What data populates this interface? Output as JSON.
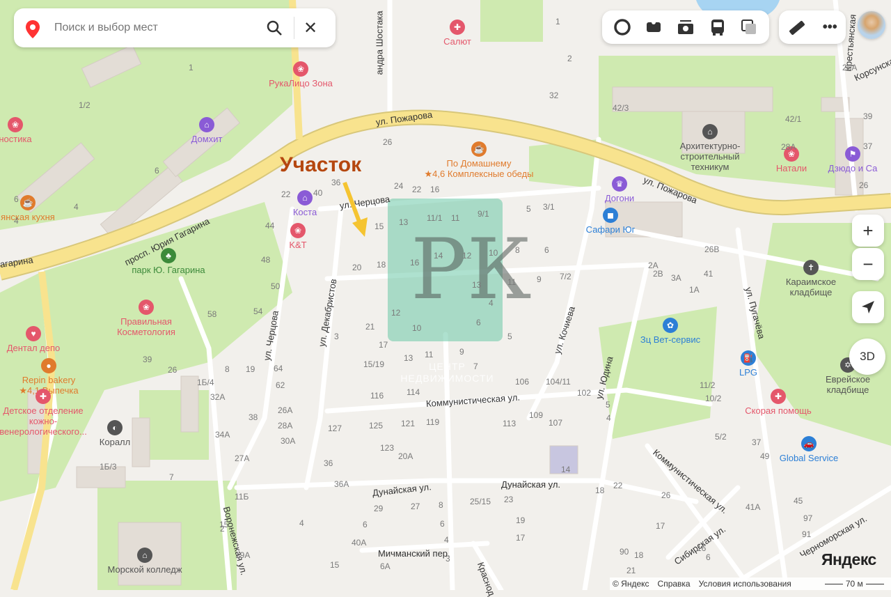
{
  "search": {
    "placeholder": "Поиск и выбор мест"
  },
  "toolbar": {
    "layers_icon": "layers-icon",
    "items": [
      "traffic-icon",
      "panorama-icon",
      "photo-icon",
      "transit-icon",
      "layers-icon"
    ],
    "ruler": "ruler-icon",
    "more": "more-icon"
  },
  "controls": {
    "zoom_in": "+",
    "zoom_out": "−",
    "threed": "3D"
  },
  "annotation": {
    "label": "Участок",
    "color": "#b5470f",
    "arrow_color": "#f5c431"
  },
  "watermark": {
    "logo": "РК",
    "text": "ЦЕНТР НЕДВИЖИМОСТИ"
  },
  "streets": {
    "pozharova1": "ул. Пожарова",
    "pozharova2": "ул. Пожарова",
    "gagarina": "просп. Юрия Гагарина",
    "gagarina2": "агарина",
    "chertsova": "ул. Черцова",
    "chertsova2": "ул. Черцова",
    "dekabristov": "ул. Декабристов",
    "kommunisticheskaya": "Коммунистическая ул.",
    "kommunisticheskaya2": "Коммунистическая ул.",
    "dunayskaya1": "Дунайская ул.",
    "dunayskaya2": "Дунайская ул.",
    "michmansky": "Мичманский пер.",
    "voronezhskaya": "Воронежская ул.",
    "kochieva": "ул. Кочиева",
    "yudina": "ул. Юдина",
    "pugacheva": "ул. Пугачёва",
    "sibirskaya": "Сибирская ул.",
    "chernomorskaya": "Черноморская ул.",
    "shostaka": "андра Шостака",
    "krestyanskaya": "Крестьянская",
    "korsunskaya": "Корсунска",
    "krasnodar": "Краснод"
  },
  "pois": [
    {
      "name": "Салют",
      "color": "#e4576b"
    },
    {
      "name": "РукаЛицо Зона",
      "color": "#e4576b"
    },
    {
      "name": "Домхит",
      "color": "#8a5bd6"
    },
    {
      "name": "По Домашнему",
      "sub": "★4,6 Комплексные обеды",
      "color": "#e07b2d"
    },
    {
      "name": "Архитектурно-строительный техникум",
      "color": "#555"
    },
    {
      "name": "Натали",
      "color": "#e4576b"
    },
    {
      "name": "Дзюдо и Са",
      "color": "#8a5bd6"
    },
    {
      "name": "Догони",
      "color": "#8a5bd6"
    },
    {
      "name": "Сафари Юг",
      "color": "#2c7fd6"
    },
    {
      "name": "Коста",
      "color": "#8a5bd6"
    },
    {
      "name": "K&T",
      "color": "#e4576b"
    },
    {
      "name": "парк Ю. Гагарина",
      "color": "#3c8a3a"
    },
    {
      "name": "Правильная Косметология",
      "color": "#e4576b"
    },
    {
      "name": "Дентал депо",
      "color": "#e4576b"
    },
    {
      "name": "Repin bakery",
      "sub": "★4,1 Выпечка",
      "color": "#e07b2d"
    },
    {
      "name": "Детское отделение кожно-венерологического...",
      "color": "#e4576b"
    },
    {
      "name": "Коралл",
      "color": "#555"
    },
    {
      "name": "Зц Вет-сервис",
      "color": "#2c7fd6"
    },
    {
      "name": "LPG",
      "color": "#2c7fd6"
    },
    {
      "name": "Скорая помощь",
      "color": "#e4576b"
    },
    {
      "name": "Караимское кладбище",
      "color": "#555"
    },
    {
      "name": "Еврейское кладбище",
      "color": "#555"
    },
    {
      "name": "Global Service",
      "color": "#2c7fd6"
    },
    {
      "name": "Морской колледж",
      "color": "#555"
    },
    {
      "name": "ностика",
      "color": "#e4576b"
    },
    {
      "name": "янская кухня",
      "color": "#e07b2d"
    }
  ],
  "houses": [
    "26",
    "24",
    "22",
    "16",
    "36",
    "40",
    "22",
    "44",
    "48",
    "50",
    "54",
    "58",
    "15",
    "13",
    "11/1",
    "11",
    "9/1",
    "5",
    "3/1",
    "8",
    "6",
    "20",
    "18",
    "16",
    "14",
    "12",
    "10",
    "11",
    "9",
    "7/2",
    "13",
    "21",
    "12",
    "10",
    "6",
    "4",
    "3",
    "17",
    "15/19",
    "13",
    "11",
    "9",
    "7",
    "5",
    "116",
    "114",
    "106",
    "104/11",
    "102",
    "127",
    "125",
    "121",
    "119",
    "123",
    "20А",
    "113",
    "109",
    "107",
    "36",
    "36А",
    "11Б",
    "29",
    "27",
    "25/15",
    "23",
    "19",
    "17",
    "14",
    "18",
    "15",
    "19А",
    "40А",
    "8",
    "6",
    "4",
    "3",
    "1",
    "2",
    "32",
    "42/3",
    "42/1",
    "28А",
    "39",
    "37",
    "26",
    "26А",
    "26В",
    "41",
    "1А",
    "2А",
    "2В",
    "3А",
    "5",
    "4",
    "11/2",
    "10/2",
    "5/2",
    "49",
    "45",
    "41А",
    "37",
    "26",
    "16",
    "90",
    "97",
    "91",
    "18",
    "22",
    "6",
    "8",
    "19",
    "64",
    "62",
    "26А",
    "28А",
    "30А",
    "32А",
    "34А",
    "27А",
    "38",
    "39",
    "26",
    "1Б/4",
    "1Б/3",
    "7",
    "1",
    "1/2",
    "6",
    "4",
    "6",
    "4",
    "2",
    "6",
    "6А",
    "4",
    "15",
    "21",
    "17",
    "13",
    "11",
    "9",
    "7"
  ],
  "footer": {
    "copyright": "© Яндекс",
    "help": "Справка",
    "terms": "Условия использования",
    "scale": "70 м",
    "logo": "Яндекс"
  }
}
